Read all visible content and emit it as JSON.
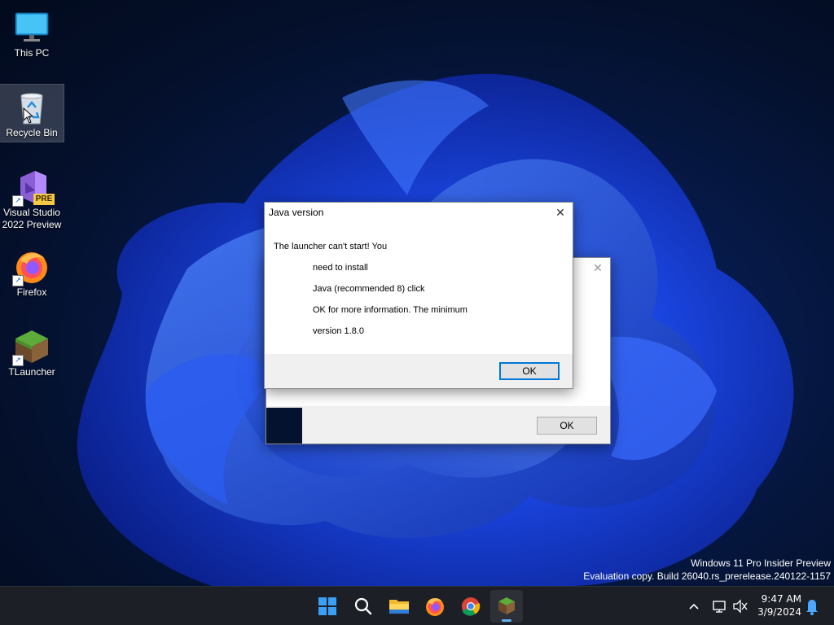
{
  "desktop": {
    "icons": [
      {
        "label": "This PC"
      },
      {
        "label": "Recycle Bin"
      },
      {
        "label": "Visual Studio 2022 Preview",
        "badge": "PRE"
      },
      {
        "label": "Firefox"
      },
      {
        "label": "TLauncher"
      }
    ]
  },
  "dialog_front": {
    "title": "Java version",
    "close_glyph": "✕",
    "lines": [
      "The launcher can't start! You",
      "need to install",
      "Java (recommended 8) click",
      "OK for more information. The minimum",
      "version 1.8.0"
    ],
    "ok_label": "OK"
  },
  "dialog_back": {
    "close_glyph": "✕",
    "ok_label": "OK"
  },
  "watermark": {
    "line1": "Windows 11 Pro Insider Preview",
    "line2": "Evaluation copy. Build 26040.rs_prerelease.240122-1157"
  },
  "taskbar": {
    "apps": [
      "start-icon",
      "search-icon",
      "file-explorer-icon",
      "firefox-icon",
      "chrome-icon",
      "tlauncher-icon"
    ],
    "tray": {
      "time": "9:47 AM",
      "date": "3/9/2024"
    }
  },
  "colors": {
    "accent": "#0078d7",
    "taskbar": "#1c1f26",
    "dialog_bg": "#f0f0f0"
  }
}
